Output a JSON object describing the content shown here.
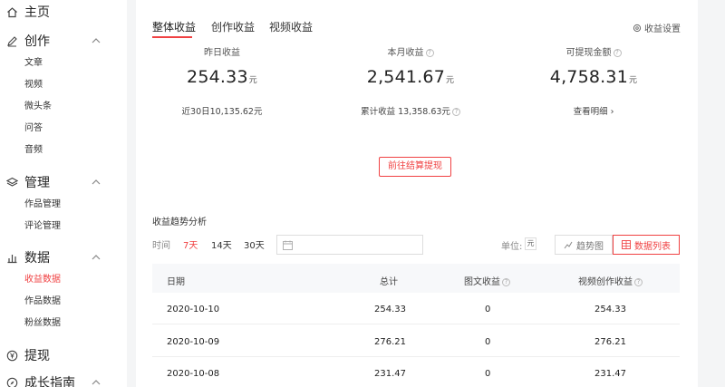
{
  "sidebar": {
    "home": "主页",
    "create": {
      "label": "创作",
      "items": [
        "文章",
        "视频",
        "微头条",
        "问答",
        "音频"
      ]
    },
    "manage": {
      "label": "管理",
      "items": [
        "作品管理",
        "评论管理"
      ]
    },
    "data": {
      "label": "数据",
      "items": [
        "收益数据",
        "作品数据",
        "粉丝数据"
      ]
    },
    "withdraw": "提现",
    "growth": "成长指南"
  },
  "tabs": [
    "整体收益",
    "创作收益",
    "视频收益"
  ],
  "settings_label": "收益设置",
  "stats": [
    {
      "title": "昨日收益",
      "value": "254.33",
      "unit": "元",
      "footer": "近30日10,135.62元"
    },
    {
      "title": "本月收益",
      "value": "2,541.67",
      "unit": "元",
      "footer": "累计收益 13,358.63元"
    },
    {
      "title": "可提现金额",
      "value": "4,758.31",
      "unit": "元",
      "footer": "查看明细 ›"
    }
  ],
  "withdraw_button": "前往结算提现",
  "trend": {
    "title": "收益趋势分析",
    "time_label": "时间",
    "ranges": [
      "7天",
      "14天",
      "30天"
    ],
    "unit_label": "单位:",
    "unit_value": "元",
    "view_trend": "趋势图",
    "view_list": "数据列表"
  },
  "table": {
    "headers": [
      "日期",
      "总计",
      "图文收益",
      "视频创作收益"
    ],
    "rows": [
      [
        "2020-10-10",
        "254.33",
        "0",
        "254.33"
      ],
      [
        "2020-10-09",
        "276.21",
        "0",
        "276.21"
      ],
      [
        "2020-10-08",
        "231.47",
        "0",
        "231.47"
      ]
    ]
  },
  "colors": {
    "accent": "#f04142"
  }
}
